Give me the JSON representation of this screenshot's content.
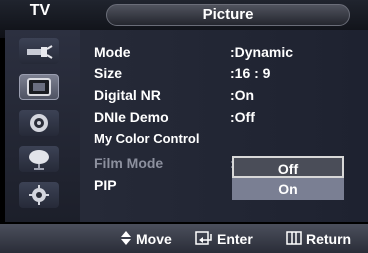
{
  "header": {
    "source_label": "TV",
    "title": "Picture"
  },
  "sidebar": {
    "items": [
      {
        "icon": "input-plug-icon"
      },
      {
        "icon": "picture-icon"
      },
      {
        "icon": "sound-icon"
      },
      {
        "icon": "channel-icon"
      },
      {
        "icon": "setup-gear-icon"
      }
    ]
  },
  "menu": {
    "items": [
      {
        "label": "Mode",
        "value": ":Dynamic"
      },
      {
        "label": "Size",
        "value": ":16 : 9"
      },
      {
        "label": "Digital NR",
        "value": ":On"
      },
      {
        "label": "DNIe Demo",
        "value": ":Off"
      },
      {
        "label": "My Color Control",
        "value": ""
      },
      {
        "label": "Film Mode",
        "value": ":"
      },
      {
        "label": "PIP",
        "value": ""
      }
    ]
  },
  "popup": {
    "options": [
      "Off",
      "On"
    ],
    "selected": "Off"
  },
  "footer": {
    "move": "Move",
    "enter": "Enter",
    "return": "Return"
  },
  "colors": {
    "background": "#000000",
    "panel": "#262a38",
    "highlight": "#7a7f93",
    "disabled_text": "#8c909e"
  }
}
